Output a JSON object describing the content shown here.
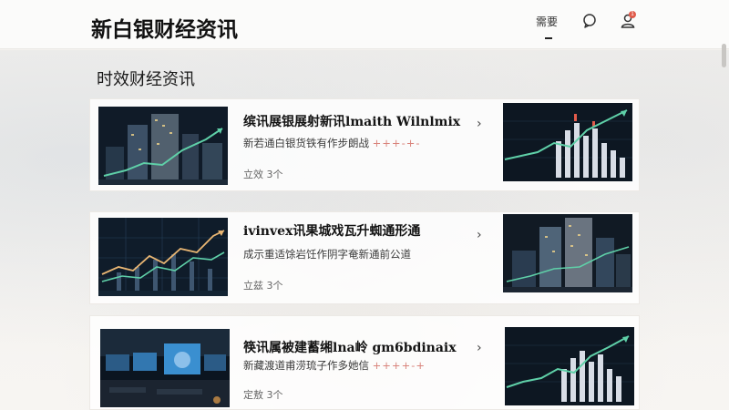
{
  "header": {
    "brand": "新白银财经资讯",
    "nav_tab": "需要",
    "message_icon": "chat-bubble-icon",
    "user_icon": "user-icon",
    "notification_count": "1"
  },
  "section": {
    "title": "时效财经资讯"
  },
  "cards": [
    {
      "title": "缤讯展银展射新讯lmaith Wilnlmix",
      "subtitle": "新若通白银货铁有作步朗战",
      "subtitle_marks": "+++-+-",
      "meta": "立效 3个",
      "left_image": "night-city-buildings-chart",
      "right_image": "stock-bar-chart-arrow"
    },
    {
      "title": "ivinvex讯果城戏瓦升蜘通形通",
      "subtitle": "成示重适馀岩饪作阴字奄新通前公道",
      "subtitle_marks": "",
      "meta": "立兹 3个",
      "left_image": "stock-line-chart-arrow",
      "right_image": "night-city-buildings"
    },
    {
      "title": "筷讯属被建蓄缃lna岭 gm6bdinaix",
      "subtitle": "新藏渡道甫涝琉子作多她信",
      "subtitle_marks": "++++-+",
      "meta": "定敖 3个",
      "left_image": "trading-room-screens",
      "right_image": "stock-bar-chart-arrow"
    }
  ],
  "colors": {
    "accent_green": "#5fd0a8",
    "chart_bar": "#d8dde6",
    "chart_red": "#e35b4b",
    "badge": "#e05a4a"
  }
}
